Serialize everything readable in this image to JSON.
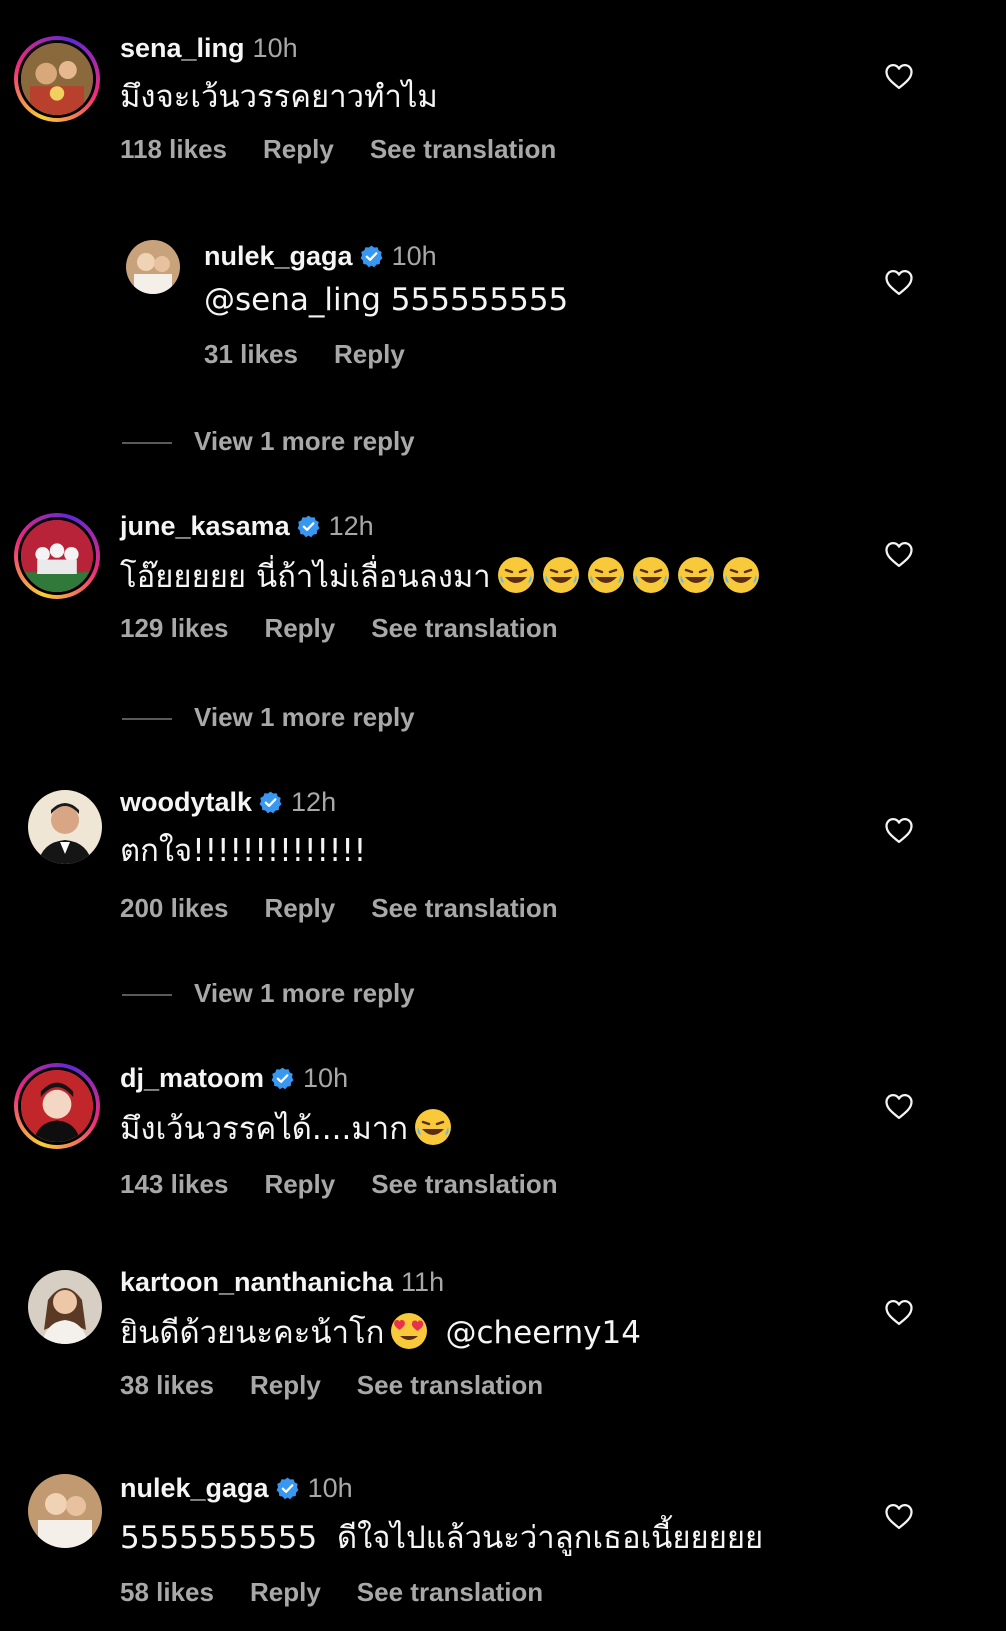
{
  "comments": [
    {
      "username": "sena_ling",
      "verified": false,
      "time": "10h",
      "text": "มึงจะเว้นวรรคยาวทำไม",
      "likes": "118 likes",
      "reply_label": "Reply",
      "translate_label": "See translation",
      "avatar_icon": "profile-photo"
    },
    {
      "username": "nulek_gaga",
      "verified": true,
      "time": "10h",
      "text": "@sena_ling 555555555",
      "likes": "31 likes",
      "reply_label": "Reply",
      "avatar_icon": "profile-photo"
    },
    {
      "username": "june_kasama",
      "verified": true,
      "time": "12h",
      "text": "โอ๊ยยยยย นี่ถ้าไม่เลื่อนลงมา",
      "emoji": "😂😂😂😂😂😂",
      "likes": "129 likes",
      "reply_label": "Reply",
      "translate_label": "See translation",
      "avatar_icon": "profile-photo"
    },
    {
      "username": "woodytalk",
      "verified": true,
      "time": "12h",
      "text": "ตกใจ!!!!!!!!!!!!!!",
      "likes": "200 likes",
      "reply_label": "Reply",
      "translate_label": "See translation",
      "avatar_icon": "profile-photo"
    },
    {
      "username": "dj_matoom",
      "verified": true,
      "time": "10h",
      "text": "มึงเว้นวรรคได้....มาก",
      "emoji": "😂",
      "likes": "143 likes",
      "reply_label": "Reply",
      "translate_label": "See translation",
      "avatar_icon": "profile-photo"
    },
    {
      "username": "kartoon_nanthanicha",
      "verified": false,
      "time": "11h",
      "text": "ยินดีด้วยนะคะน้าโก",
      "emoji": "😍",
      "text_after": "@cheerny14",
      "likes": "38 likes",
      "reply_label": "Reply",
      "translate_label": "See translation",
      "avatar_icon": "profile-photo"
    },
    {
      "username": "nulek_gaga",
      "verified": true,
      "time": "10h",
      "text": "5555555555  ดีใจไปแล้วนะว่าลูกเธอเนี้ยยยยย",
      "likes": "58 likes",
      "reply_label": "Reply",
      "translate_label": "See translation",
      "avatar_icon": "profile-photo"
    }
  ],
  "view_more": [
    "View 1 more reply",
    "View 1 more reply",
    "View 1 more reply"
  ],
  "icons": {
    "like": "heart-outline-icon",
    "verified": "verified-badge-icon"
  },
  "colors": {
    "background": "#000000",
    "primary_text": "#f5f5f5",
    "secondary_text": "#a8a8a8",
    "verified_blue": "#3897f0"
  }
}
